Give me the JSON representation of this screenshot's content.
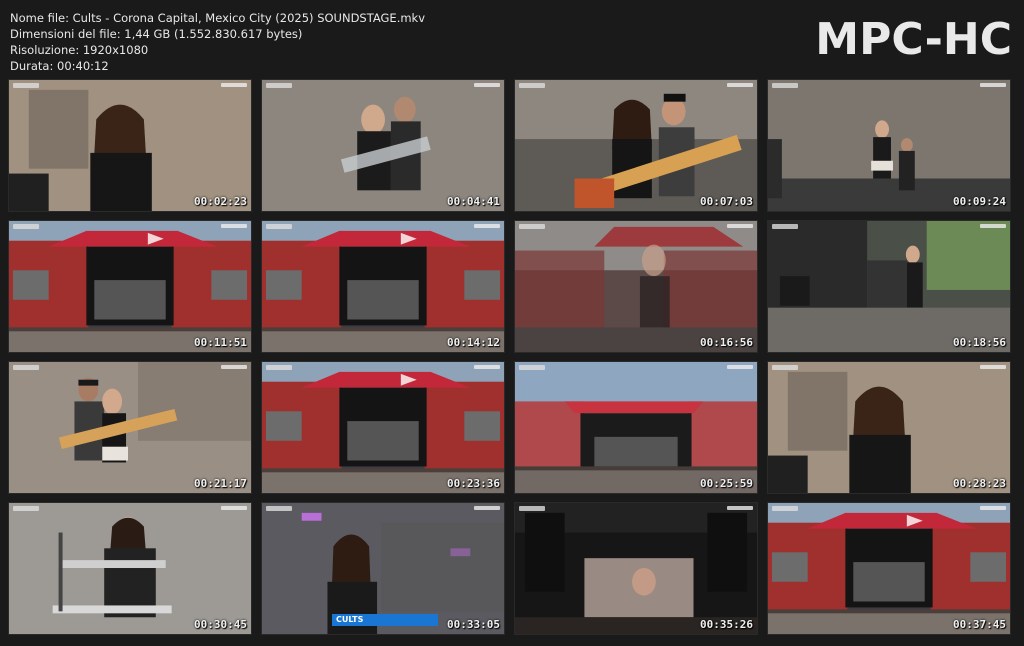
{
  "file_info": {
    "name": "Nome file: Cults - Corona Capital, Mexico City (2025) SOUNDSTAGE.mkv",
    "size": "Dimensioni del file: 1,44 GB (1.552.830.617 bytes)",
    "resolution": "Risoluzione: 1920x1080",
    "duration": "Durata: 00:40:12"
  },
  "logo": "MPC-HC",
  "lower_third_label": "CULTS",
  "thumbnails": [
    {
      "time": "00:02:23",
      "scene": "closeup-singer"
    },
    {
      "time": "00:04:41",
      "scene": "duo-guitar"
    },
    {
      "time": "00:07:03",
      "scene": "duo-guitar-bright"
    },
    {
      "time": "00:09:24",
      "scene": "wide-duo"
    },
    {
      "time": "00:11:51",
      "scene": "stage-wide"
    },
    {
      "time": "00:14:12",
      "scene": "stage-wide"
    },
    {
      "time": "00:16:56",
      "scene": "stage-overlay"
    },
    {
      "time": "00:18:56",
      "scene": "stage-side"
    },
    {
      "time": "00:21:17",
      "scene": "duo-guitar-warm"
    },
    {
      "time": "00:23:36",
      "scene": "stage-wide"
    },
    {
      "time": "00:25:59",
      "scene": "stage-far"
    },
    {
      "time": "00:28:23",
      "scene": "closeup-singer"
    },
    {
      "time": "00:30:45",
      "scene": "keyboard"
    },
    {
      "time": "00:33:05",
      "scene": "singer-lights"
    },
    {
      "time": "00:35:26",
      "scene": "stage-night"
    },
    {
      "time": "00:37:45",
      "scene": "stage-wide"
    }
  ]
}
